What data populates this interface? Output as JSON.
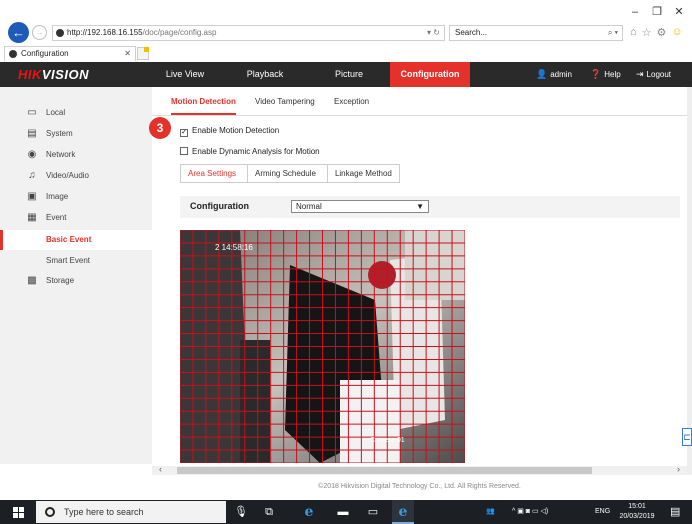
{
  "browser": {
    "url_host": "http://192.168.16.155",
    "url_path": "/doc/page/config.asp",
    "search_placeholder": "Search...",
    "tab_title": "Configuration"
  },
  "app": {
    "logo_prefix": "HIK",
    "logo_suffix": "VISION",
    "nav": [
      "Live View",
      "Playback",
      "Picture",
      "Configuration"
    ],
    "active_nav": "Configuration",
    "user": "admin",
    "help": "Help",
    "logout": "Logout"
  },
  "sidebar": {
    "items": [
      {
        "label": "Local",
        "icon": "monitor-icon"
      },
      {
        "label": "System",
        "icon": "system-icon"
      },
      {
        "label": "Network",
        "icon": "globe-icon"
      },
      {
        "label": "Video/Audio",
        "icon": "video-audio-icon"
      },
      {
        "label": "Image",
        "icon": "image-icon"
      },
      {
        "label": "Event",
        "icon": "event-icon"
      },
      {
        "label": "Basic Event",
        "icon": ""
      },
      {
        "label": "Smart Event",
        "icon": ""
      },
      {
        "label": "Storage",
        "icon": "storage-icon"
      }
    ],
    "active_item": "Basic Event"
  },
  "main": {
    "subtabs": [
      "Motion Detection",
      "Video Tampering",
      "Exception"
    ],
    "active_subtab": "Motion Detection",
    "step_badge": "3",
    "enable_motion_label": "Enable Motion Detection",
    "enable_motion_checked": true,
    "enable_dynamic_label": "Enable Dynamic Analysis for Motion",
    "enable_dynamic_checked": false,
    "settings_tabs": [
      "Area Settings",
      "Arming Schedule",
      "Linkage Method"
    ],
    "active_settings_tab": "Area Settings",
    "configuration_label": "Configuration",
    "configuration_value": "Normal",
    "video_osd_time": "2 14:58:16",
    "video_osd_camera": "Camera 01",
    "grid_color": "#c8101c"
  },
  "footer": {
    "copyright": "©2018 Hikvision Digital Technology Co., Ltd. All Rights Reserved."
  },
  "taskbar": {
    "search_placeholder": "Type here to search",
    "language": "ENG",
    "time": "15:01",
    "date": "20/03/2019"
  }
}
